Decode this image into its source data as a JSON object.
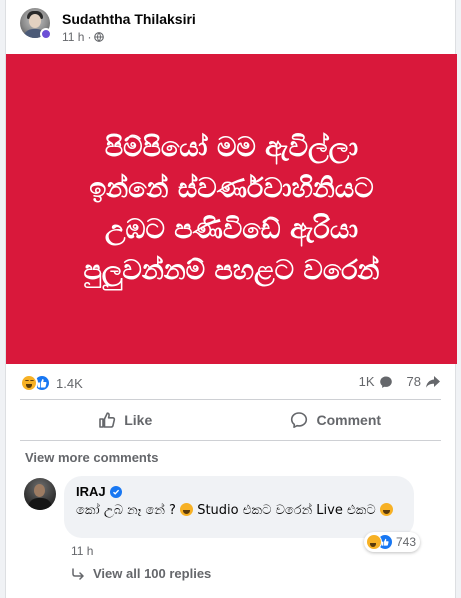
{
  "post": {
    "author": "Sudaththa Thilaksiri",
    "time": "11 h",
    "separator": "·",
    "image_text": "පිම්පියෝ මම ඇවිල්ලා\nඉන්නේ ස්වර්ණවාහිනියට\nඋඹට පණිවිඩේ ඇරියා\nපුලුවන්නම් පහළට වරෙන්",
    "image_bg": "#d9183b"
  },
  "stats": {
    "reactions_count": "1.4K",
    "comments_count": "1K",
    "shares_count": "78"
  },
  "actions": {
    "like_label": "Like",
    "comment_label": "Comment"
  },
  "comments": {
    "view_more_label": "View more comments",
    "items": [
      {
        "author": "IRAJ",
        "text": "කෝ උබ නෑ නේ ? ",
        "text_tail": " Studio එකට වරෙන් Live එකට ",
        "time": "11 h",
        "reactions": "743",
        "view_replies_label": "View all 100 replies"
      }
    ]
  },
  "colors": {
    "accent": "#1877f2",
    "haha": "#f7b125",
    "muted": "#65676b"
  },
  "icons": [
    "globe-icon",
    "haha-reaction-icon",
    "like-reaction-icon",
    "comment-count-icon",
    "share-icon",
    "like-icon",
    "comment-icon",
    "verified-icon",
    "reply-arrow-icon"
  ]
}
